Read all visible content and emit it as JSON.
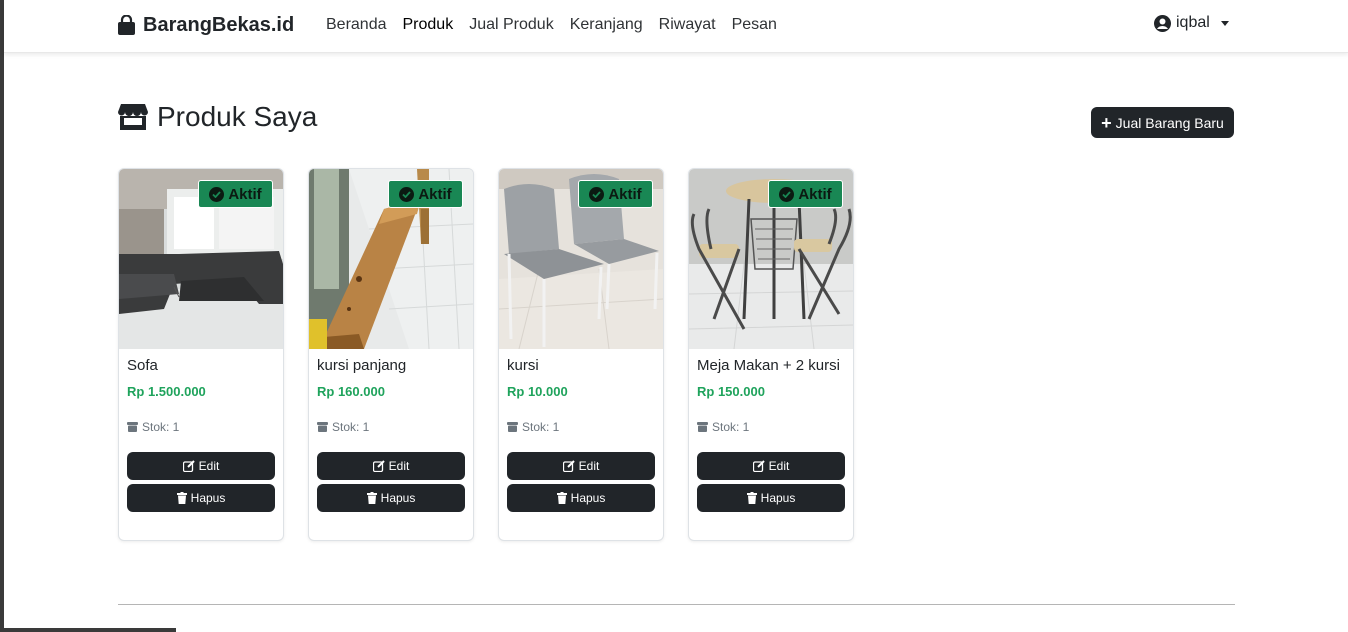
{
  "navbar": {
    "brand": "BarangBekas.id",
    "brand_icon": "shopping-bag-icon",
    "links": [
      {
        "label": "Beranda"
      },
      {
        "label": "Produk"
      },
      {
        "label": "Jual Produk"
      },
      {
        "label": "Keranjang"
      },
      {
        "label": "Riwayat"
      },
      {
        "label": "Pesan"
      }
    ],
    "active_link": "Produk",
    "user": "iqbal",
    "user_icon": "user-circle-icon"
  },
  "page": {
    "title": "Produk Saya",
    "title_icon": "store-icon",
    "new_button": "Jual Barang Baru"
  },
  "colors": {
    "dark": "#212529",
    "success": "#198754",
    "price": "#1fa35c",
    "muted": "#6c757d"
  },
  "products": [
    {
      "name": "Sofa",
      "price": "Rp 1.500.000",
      "stock": "Stok: 1",
      "status": "Aktif",
      "edit": "Edit",
      "delete": "Hapus"
    },
    {
      "name": "kursi panjang",
      "price": "Rp 160.000",
      "stock": "Stok: 1",
      "status": "Aktif",
      "edit": "Edit",
      "delete": "Hapus"
    },
    {
      "name": "kursi",
      "price": "Rp 10.000",
      "stock": "Stok: 1",
      "status": "Aktif",
      "edit": "Edit",
      "delete": "Hapus"
    },
    {
      "name": "Meja Makan + 2 kursi",
      "price": "Rp 150.000",
      "stock": "Stok: 1",
      "status": "Aktif",
      "edit": "Edit",
      "delete": "Hapus"
    }
  ]
}
